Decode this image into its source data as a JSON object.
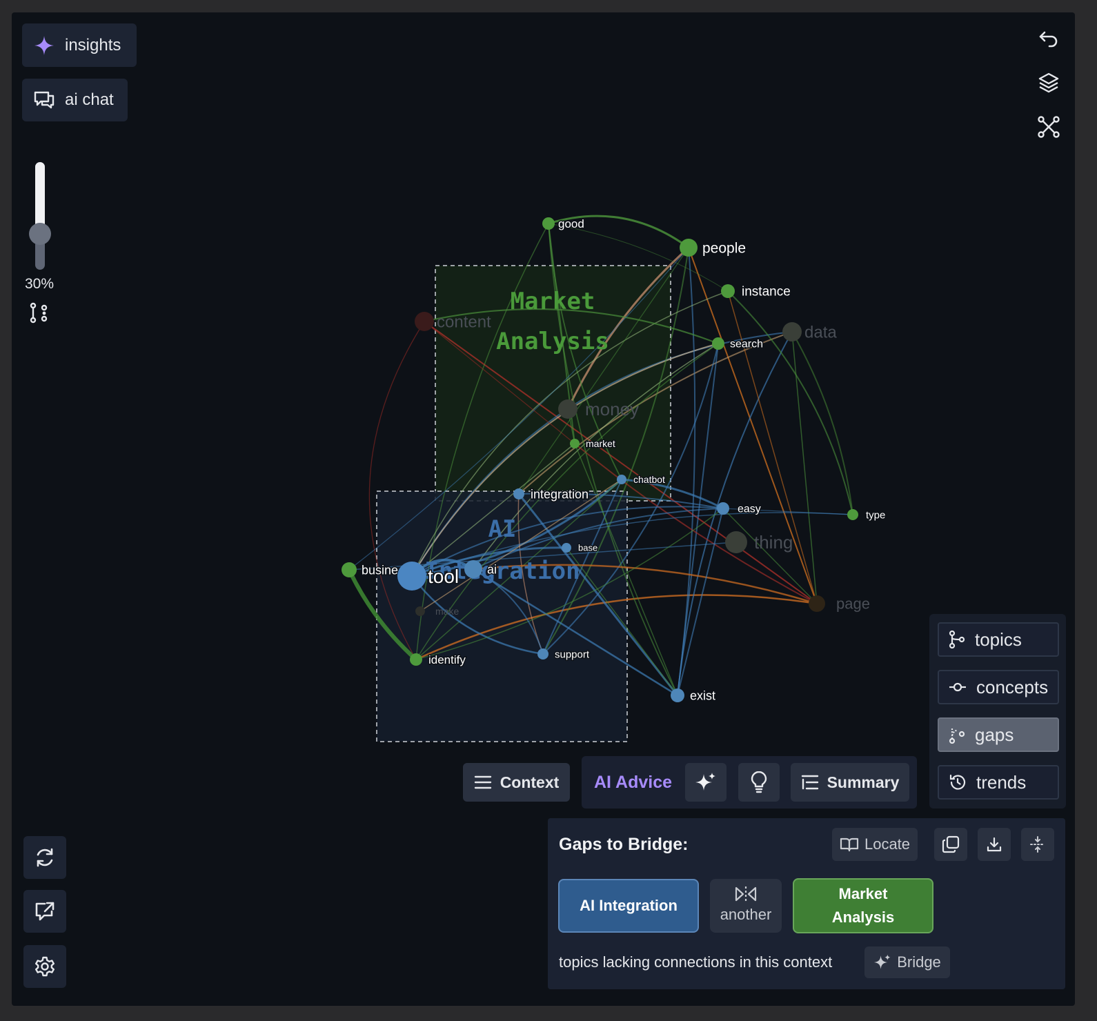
{
  "left_toolbar": {
    "insights_label": "insights",
    "ai_chat_label": "ai chat",
    "zoom_level": "30%",
    "slider_fraction": 0.3
  },
  "graph": {
    "clusters": [
      {
        "name": "Market Analysis",
        "line1": "Market",
        "line2": "Analysis",
        "color": "#4a9a3a"
      },
      {
        "name": "AI Integration",
        "line1": "AI",
        "line2": "Integration",
        "color": "#3b6ea8"
      }
    ],
    "nodes": [
      {
        "id": "good",
        "label": "good"
      },
      {
        "id": "people",
        "label": "people"
      },
      {
        "id": "instance",
        "label": "instance"
      },
      {
        "id": "content",
        "label": "content"
      },
      {
        "id": "data",
        "label": "data"
      },
      {
        "id": "search",
        "label": "search"
      },
      {
        "id": "money",
        "label": "money"
      },
      {
        "id": "market",
        "label": "market"
      },
      {
        "id": "chatbot",
        "label": "chatbot"
      },
      {
        "id": "integration",
        "label": "integration"
      },
      {
        "id": "easy",
        "label": "easy"
      },
      {
        "id": "type",
        "label": "type"
      },
      {
        "id": "thing",
        "label": "thing"
      },
      {
        "id": "base",
        "label": "base"
      },
      {
        "id": "business",
        "label": "busine"
      },
      {
        "id": "tool",
        "label": "tool"
      },
      {
        "id": "ai",
        "label": "ai"
      },
      {
        "id": "make",
        "label": "make"
      },
      {
        "id": "page",
        "label": "page"
      },
      {
        "id": "identify",
        "label": "identify"
      },
      {
        "id": "support",
        "label": "support"
      },
      {
        "id": "exist",
        "label": "exist"
      }
    ]
  },
  "view_modes": {
    "items": [
      {
        "label": "topics",
        "icon": "topics-branch-icon",
        "active": false
      },
      {
        "label": "concepts",
        "icon": "concepts-node-icon",
        "active": false
      },
      {
        "label": "gaps",
        "icon": "gaps-branch-icon",
        "active": true
      },
      {
        "label": "trends",
        "icon": "history-clock-icon",
        "active": false
      }
    ]
  },
  "action_bar": {
    "context_label": "Context",
    "ai_advice_label": "AI Advice",
    "summary_label": "Summary"
  },
  "gaps_panel": {
    "title": "Gaps to Bridge:",
    "locate_label": "Locate",
    "gap_a": "AI Integration",
    "another_label": "another",
    "gap_b_line1": "Market",
    "gap_b_line2": "Analysis",
    "description": "topics lacking connections in this context",
    "bridge_label": "Bridge",
    "colors": {
      "gap_a": "#2f5c8e",
      "gap_b": "#3f7f34"
    }
  }
}
